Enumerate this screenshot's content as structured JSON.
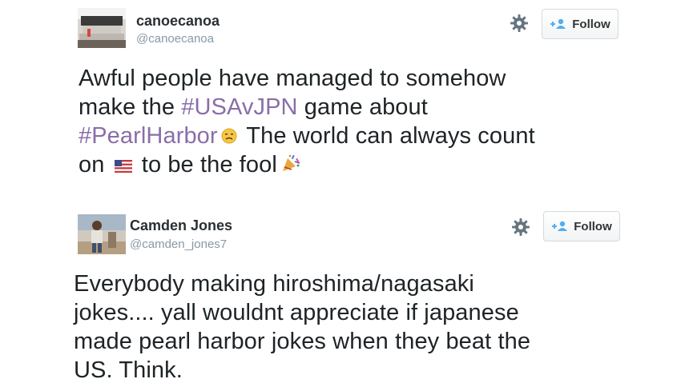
{
  "tweets": [
    {
      "display_name": "canoecanoa",
      "handle": "@canoecanoa",
      "follow_label": "Follow",
      "text": {
        "line1": "Awful people have managed to somehow",
        "line2_pre": "make the ",
        "line2_hashtag": "#USAvJPN",
        "line2_post": " game about",
        "line3_hashtag": "#PearlHarbor",
        "line3_post": " The world can always count",
        "line4_pre": "on ",
        "line4_post": " to be the fool"
      },
      "emojis": [
        "disappointed-face",
        "us-flag",
        "party-popper"
      ]
    },
    {
      "display_name": "Camden Jones",
      "handle": "@camden_jones7",
      "follow_label": "Follow",
      "text": {
        "line1": "Everybody making hiroshima/nagasaki",
        "line2": "jokes.... yall wouldnt appreciate if japanese",
        "line3": "made pearl harbor jokes when they beat the",
        "line4": "US. Think."
      }
    }
  ],
  "icons": {
    "gear": "gear-icon",
    "follow": "add-person-icon"
  },
  "colors": {
    "hashtag": "#8a6ea8",
    "handle": "#8899a6",
    "text": "#1e2326"
  }
}
